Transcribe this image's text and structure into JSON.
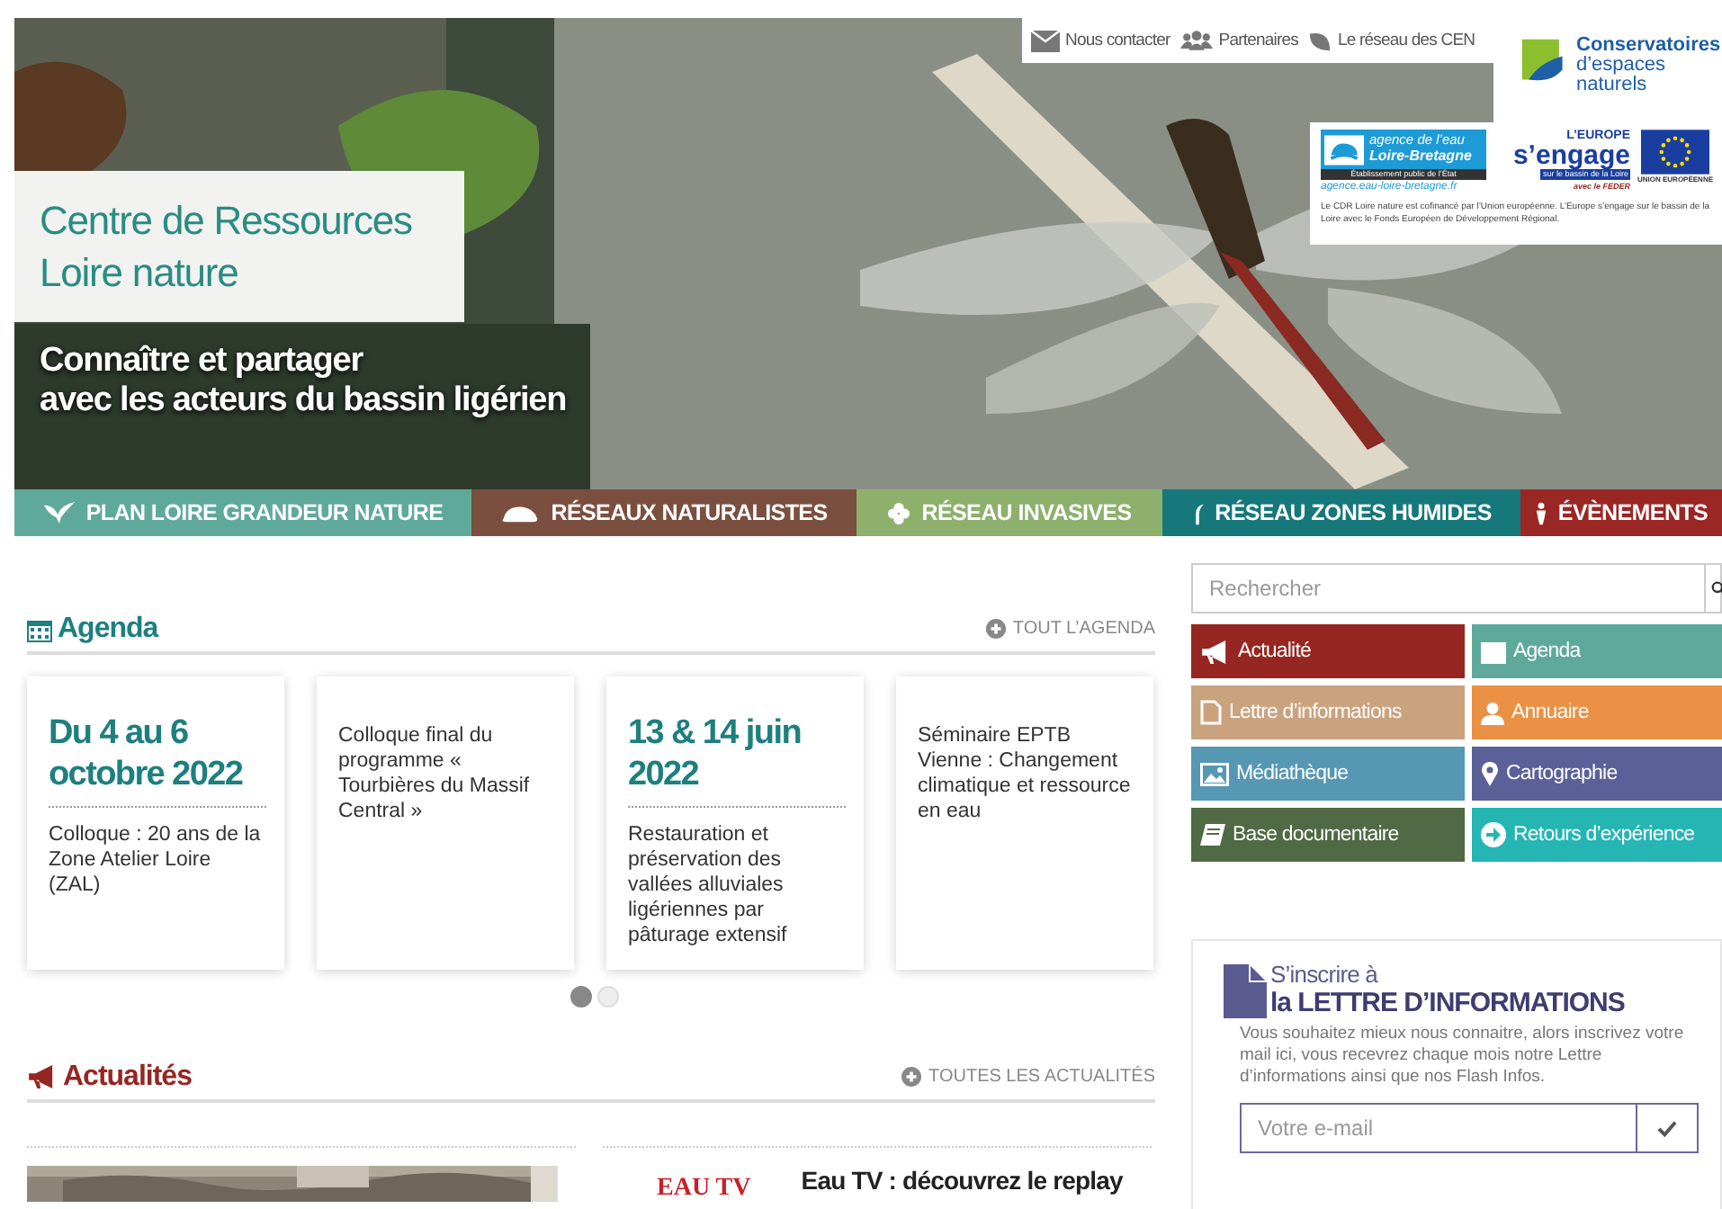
{
  "top_links": [
    {
      "label": "Nous contacter"
    },
    {
      "label": "Partenaires"
    },
    {
      "label": "Le réseau des CEN"
    }
  ],
  "hero": {
    "kind": "picture",
    "title": [
      "Centre de Ressources",
      "Loire nature"
    ],
    "tagline": [
      "Connaître et partager",
      "avec les acteurs du bassin ligérien"
    ]
  },
  "partners": {
    "cen": [
      "Conservatoires",
      "d’espaces",
      "naturels"
    ],
    "agence": {
      "name": "agence de l’eau",
      "region": "Loire-Bretagne",
      "status": "Établissement public de l’État",
      "url": "agence.eau-loire-bretagne.fr"
    },
    "europe": {
      "top": "L’EUROPE",
      "main": "s’engage",
      "sub": "sur le bassin de la Loire",
      "fund": "avec le FEDER"
    },
    "eu": {
      "label": "UNION EUROPÉENNE"
    },
    "caption": "Le CDR Loire nature est cofinancé par l’Union européenne. L’Europe s’engage sur le bassin de la Loire avec le Fonds Européen de Développement Régional."
  },
  "nav": [
    {
      "label": "PLAN LOIRE GRANDEUR NATURE",
      "color": "#5fa99b"
    },
    {
      "label": "RÉSEAUX NATURALISTES",
      "color": "#7b4f3f"
    },
    {
      "label": "RÉSEAU INVASIVES",
      "color": "#8db06c"
    },
    {
      "label": "RÉSEAU ZONES HUMIDES",
      "color": "#16787b"
    },
    {
      "label": "ÉVÈNEMENTS",
      "color": "#9a2724"
    }
  ],
  "agenda": {
    "title": "Agenda",
    "more": "TOUT L’AGENDA",
    "cards": [
      {
        "date": "Du 4 au 6 octobre 2022",
        "text": "Colloque : 20 ans de la Zone Atelier Loire (ZAL)"
      },
      {
        "text": "Colloque final du programme « Tourbières du Massif Central »"
      },
      {
        "date": "13 & 14 juin 2022",
        "text": "Restauration et préservation des vallées alluviales ligériennes par pâturage extensif"
      },
      {
        "text": "Séminaire EPTB Vienne : Changement climatique et ressource en eau"
      }
    ],
    "dots": [
      {
        "selected": true
      },
      {
        "selected": false
      }
    ]
  },
  "news": {
    "title": "Actualités",
    "more": "TOUTES LES ACTUALITÉS",
    "items": [
      {
        "kind": "picture"
      },
      {
        "kind": "article",
        "logo": "EAU TV",
        "title": "Eau TV : découvrez le replay"
      }
    ]
  },
  "search": {
    "placeholder": "Rechercher"
  },
  "quick_links": [
    {
      "label": "Actualité",
      "color": "#962621"
    },
    {
      "label": "Agenda",
      "color": "#5fa99b"
    },
    {
      "label": "Lettre d’informations",
      "color": "#caa27e"
    },
    {
      "label": "Annuaire",
      "color": "#ea9145"
    },
    {
      "label": "Médiathèque",
      "color": "#5697b4"
    },
    {
      "label": "Cartographie",
      "color": "#5c6099"
    },
    {
      "label": "Base documentaire",
      "color": "#4f6a44"
    },
    {
      "label": "Retours d’expérience",
      "color": "#25b6b3"
    }
  ],
  "newsletter": {
    "kicker": "S’inscrire à",
    "title": "la LETTRE D’INFORMATIONS",
    "text": "Vous souhaitez mieux nous connaitre, alors inscrivez votre mail ici, vous recevrez chaque mois notre Lettre d’informations ainsi que nos Flash Infos.",
    "placeholder": "Votre e-mail"
  }
}
